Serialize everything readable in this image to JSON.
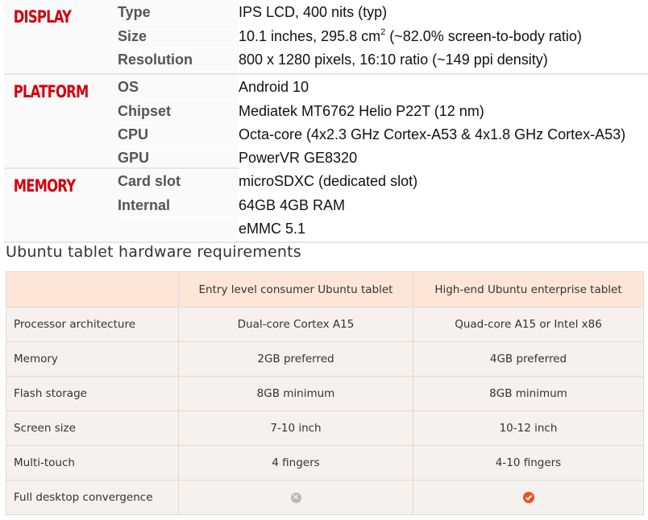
{
  "specs": {
    "sections": [
      {
        "category": "DISPLAY",
        "rows": [
          {
            "key": "Type",
            "value": "IPS LCD, 400 nits (typ)"
          },
          {
            "key": "Size",
            "value": "10.1 inches, 295.8 cm",
            "sup": "2",
            "value_after": " (~82.0% screen-to-body ratio)"
          },
          {
            "key": "Resolution",
            "value": "800 x 1280 pixels, 16:10 ratio (~149 ppi density)"
          }
        ]
      },
      {
        "category": "PLATFORM",
        "rows": [
          {
            "key": "OS",
            "value": "Android 10"
          },
          {
            "key": "Chipset",
            "value": "Mediatek MT6762 Helio P22T (12 nm)"
          },
          {
            "key": "CPU",
            "value": "Octa-core (4x2.3 GHz Cortex-A53 & 4x1.8 GHz Cortex-A53)"
          },
          {
            "key": "GPU",
            "value": "PowerVR GE8320"
          }
        ]
      },
      {
        "category": "MEMORY",
        "rows": [
          {
            "key": "Card slot",
            "value": "microSDXC (dedicated slot)"
          },
          {
            "key": "Internal",
            "value": "64GB 4GB RAM"
          },
          {
            "key": "",
            "value": "eMMC 5.1"
          }
        ]
      }
    ]
  },
  "caption": "Ubuntu tablet hardware requirements",
  "requirements": {
    "headers": [
      "",
      "Entry level consumer Ubuntu tablet",
      "High-end Ubuntu enterprise tablet"
    ],
    "rows": [
      {
        "label": "Processor architecture",
        "entry": "Dual-core Cortex A15",
        "high": "Quad-core A15 or Intel x86"
      },
      {
        "label": "Memory",
        "entry": "2GB preferred",
        "high": "4GB preferred"
      },
      {
        "label": "Flash storage",
        "entry": "8GB minimum",
        "high": "8GB minimum"
      },
      {
        "label": "Screen size",
        "entry": "7-10 inch",
        "high": "10-12 inch"
      },
      {
        "label": "Multi-touch",
        "entry": "4 fingers",
        "high": "4-10 fingers"
      },
      {
        "label": "Full desktop convergence",
        "entry_icon": "cross-circle-icon",
        "high_icon": "check-circle-icon"
      }
    ]
  },
  "colors": {
    "category_red": "#d5000d",
    "header_peach": "#fde6d8",
    "ubuntu_orange": "#e95420"
  }
}
